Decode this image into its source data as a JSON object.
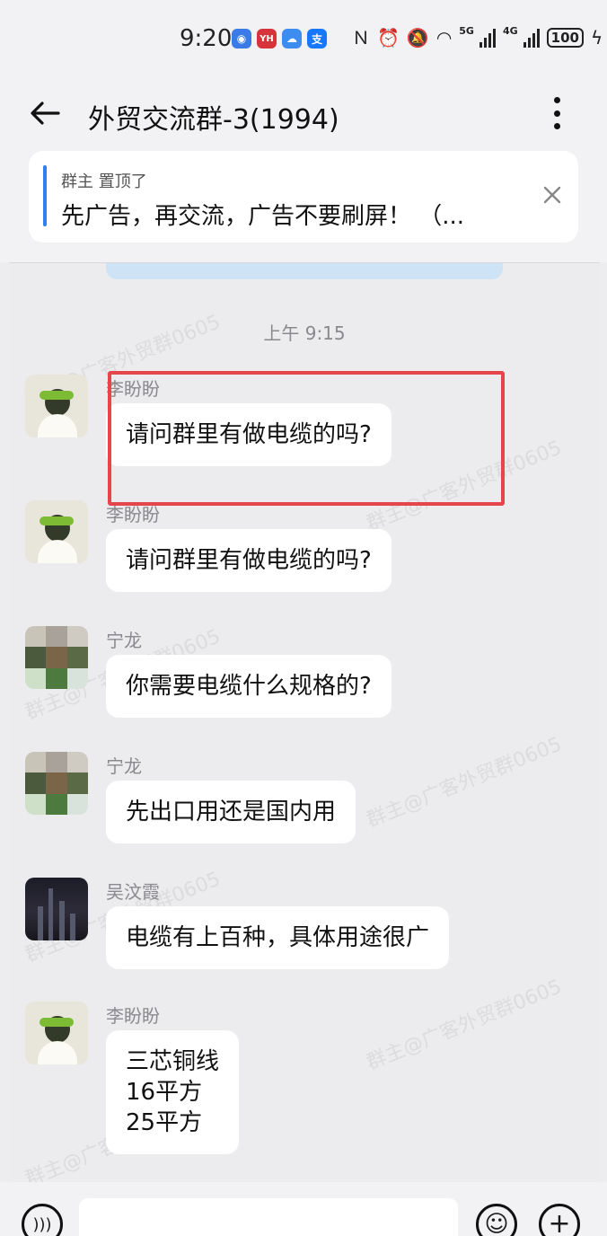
{
  "status_bar": {
    "time": "9:20",
    "apps": [
      {
        "name": "app-icon-blue",
        "color": "#3a7be8",
        "glyph": "◉"
      },
      {
        "name": "app-icon-red",
        "color": "#d6333b",
        "glyph": "YH"
      },
      {
        "name": "app-icon-weather",
        "color": "#3d8df0",
        "glyph": "☁"
      },
      {
        "name": "alipay-icon",
        "color": "#1677ff",
        "glyph": "支"
      }
    ],
    "net_5g": "5G",
    "net_4g": "4G",
    "battery": "100"
  },
  "header": {
    "title": "外贸交流群-3(1994)"
  },
  "pinned": {
    "meta": "群主 置顶了",
    "text": "先广告，再交流，广告不要刷屏！ （..."
  },
  "chat": {
    "time_separator": "上午 9:15",
    "messages": [
      {
        "sender": "李盼盼",
        "text": "请问群里有做电缆的吗?",
        "avatar": "girl"
      },
      {
        "sender": "李盼盼",
        "text": "请问群里有做电缆的吗?",
        "avatar": "girl"
      },
      {
        "sender": "宁龙",
        "text": "你需要电缆什么规格的?",
        "avatar": "pixel"
      },
      {
        "sender": "宁龙",
        "text": "先出口用还是国内用",
        "avatar": "pixel"
      },
      {
        "sender": "吴汶霞",
        "text": "电缆有上百种，具体用途很广",
        "avatar": "city"
      },
      {
        "sender": "李盼盼",
        "text": "三芯铜线\n16平方\n25平方",
        "avatar": "girl"
      }
    ],
    "watermark": "群主@广客外贸群0605"
  },
  "input": {
    "placeholder": ""
  },
  "colors": {
    "highlight": "#e5454b",
    "pin_accent": "#2f7ff0"
  }
}
